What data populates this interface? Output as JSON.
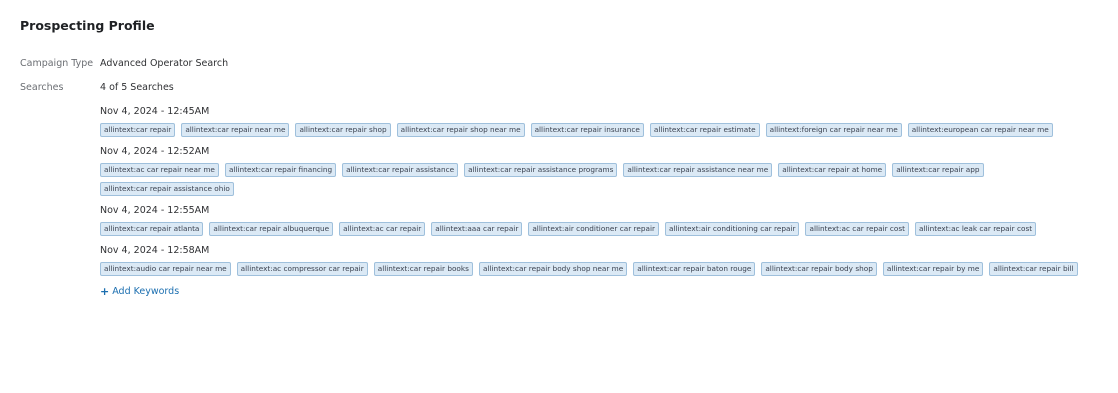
{
  "profile": {
    "title": "Prospecting Profile",
    "campaign_type_label": "Campaign Type",
    "campaign_type_value": "Advanced Operator Search",
    "searches_label": "Searches",
    "searches_count": "4 of 5 Searches",
    "add_keywords_label": "Add Keywords",
    "add_keywords_icon": "+"
  },
  "groups": [
    {
      "date": "Nov 4, 2024 - 12:45AM",
      "tags": [
        "allintext:car repair",
        "allintext:car repair near me",
        "allintext:car repair shop",
        "allintext:car repair shop near me",
        "allintext:car repair insurance",
        "allintext:car repair estimate",
        "allintext:foreign car repair near me",
        "allintext:european car repair near me"
      ]
    },
    {
      "date": "Nov 4, 2024 - 12:52AM",
      "tags": [
        "allintext:ac car repair near me",
        "allintext:car repair financing",
        "allintext:car repair assistance",
        "allintext:car repair assistance programs",
        "allintext:car repair assistance near me",
        "allintext:car repair at home",
        "allintext:car repair app",
        "allintext:car repair assistance ohio"
      ]
    },
    {
      "date": "Nov 4, 2024 - 12:55AM",
      "tags": [
        "allintext:car repair atlanta",
        "allintext:car repair albuquerque",
        "allintext:ac car repair",
        "allintext:aaa car repair",
        "allintext:air conditioner car repair",
        "allintext:air conditioning car repair",
        "allintext:ac car repair cost",
        "allintext:ac leak car repair cost"
      ]
    },
    {
      "date": "Nov 4, 2024 - 12:58AM",
      "tags": [
        "allintext:audio car repair near me",
        "allintext:ac compressor car repair",
        "allintext:car repair books",
        "allintext:car repair body shop near me",
        "allintext:car repair baton rouge",
        "allintext:car repair body shop",
        "allintext:car repair by me",
        "allintext:car repair bill"
      ]
    }
  ],
  "colors": {
    "tag_background": "#dbe9f5",
    "tag_border": "#9fc0dc",
    "link": "#1c6fb0"
  }
}
